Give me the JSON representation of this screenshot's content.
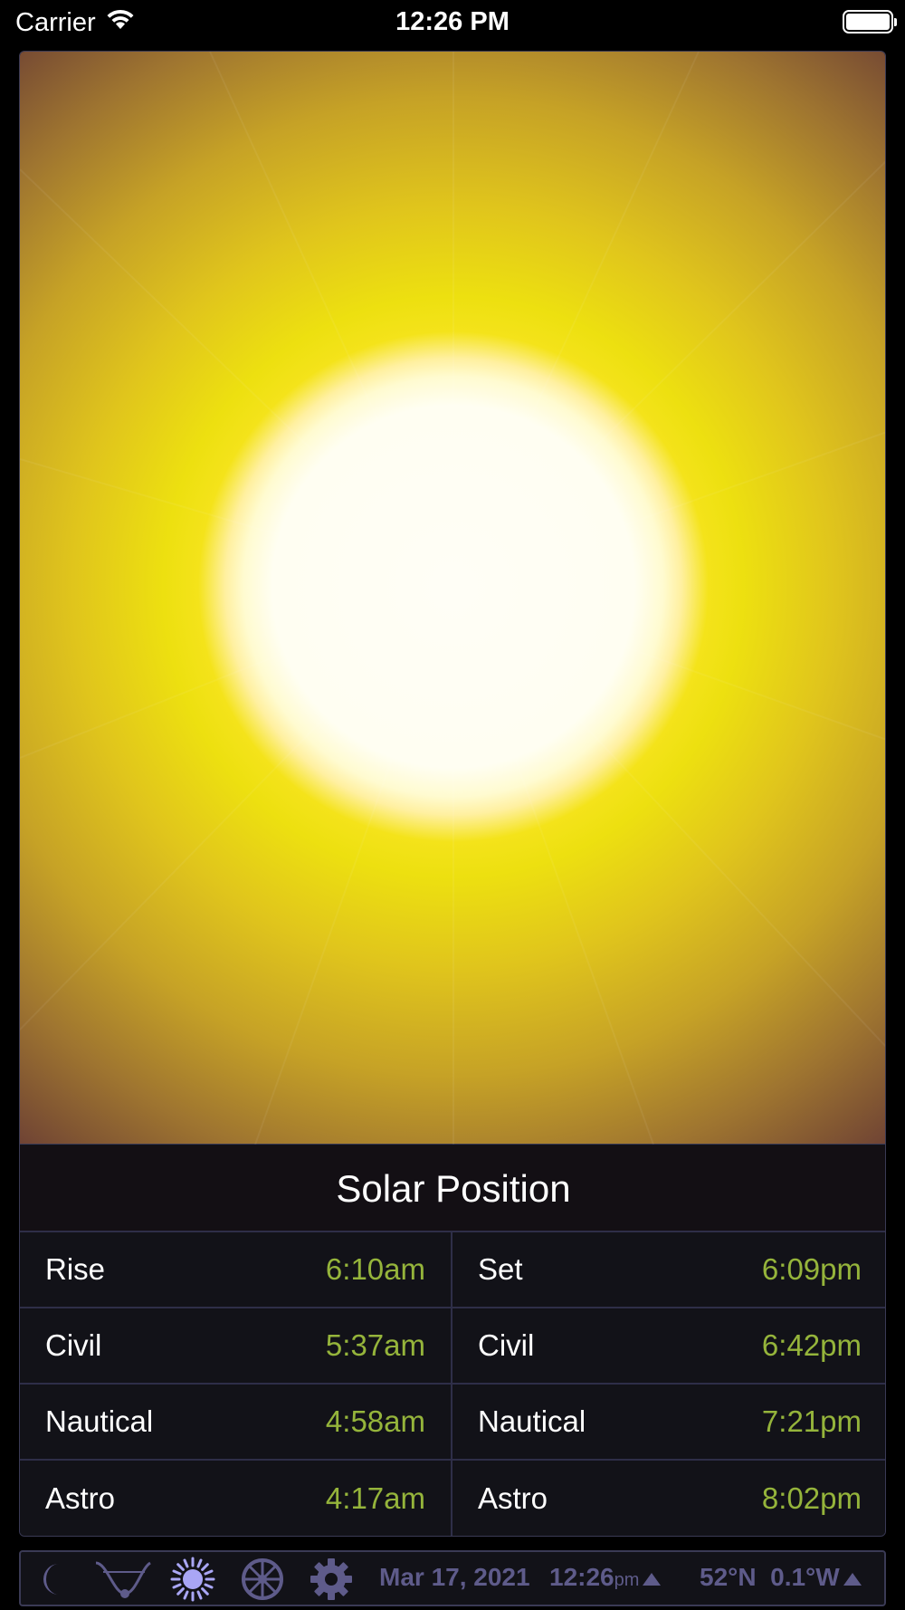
{
  "status_bar": {
    "carrier": "Carrier",
    "time": "12:26 PM"
  },
  "panel": {
    "title": "Solar Position",
    "rows": [
      {
        "left_label": "Rise",
        "left_time": "6:10am",
        "right_label": "Set",
        "right_time": "6:09pm"
      },
      {
        "left_label": "Civil",
        "left_time": "5:37am",
        "right_label": "Civil",
        "right_time": "6:42pm"
      },
      {
        "left_label": "Nautical",
        "left_time": "4:58am",
        "right_label": "Nautical",
        "right_time": "7:21pm"
      },
      {
        "left_label": "Astro",
        "left_time": "4:17am",
        "right_label": "Astro",
        "right_time": "8:02pm"
      }
    ]
  },
  "toolbar": {
    "icons": [
      "moon-icon",
      "path-curve-icon",
      "sun-icon",
      "wheel-icon",
      "gear-icon"
    ],
    "date": "Mar 17, 2021",
    "time": "12:26",
    "ampm": "pm",
    "location": "52°N  0.1°W"
  },
  "colors": {
    "time_value": "#95b43b",
    "toolbar_accent": "#5e5b8a",
    "active_icon": "#a9a6f5"
  }
}
